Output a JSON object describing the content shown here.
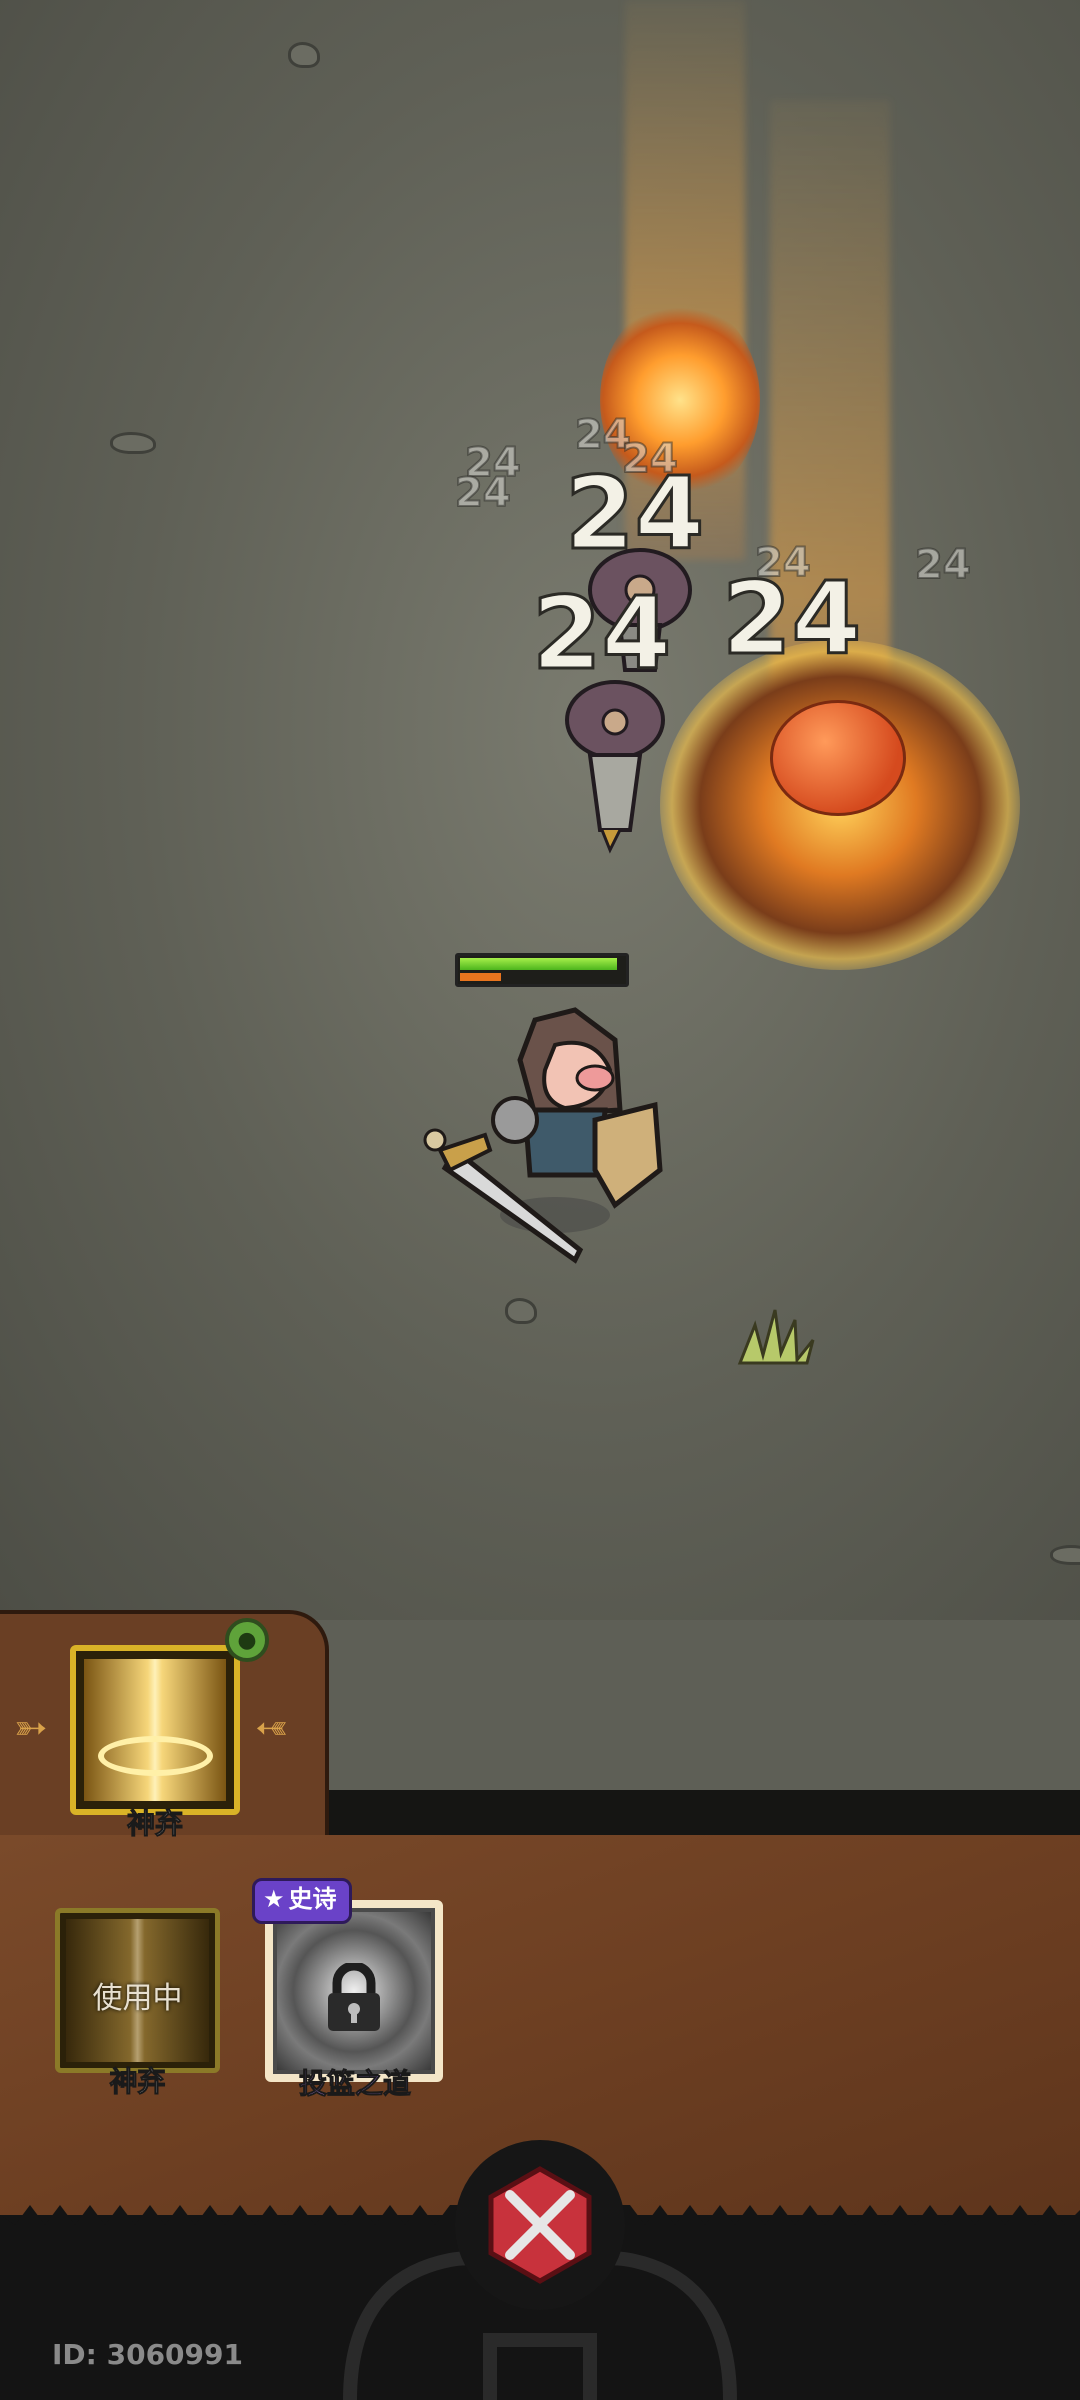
{
  "combat": {
    "damage_numbers_large": [
      "24",
      "24",
      "24"
    ],
    "damage_numbers_small": [
      "24",
      "24",
      "24",
      "24",
      "24",
      "24"
    ],
    "player_health_fraction": 0.97,
    "player_experience_fraction": 0.25
  },
  "equipped_skill": {
    "label": "神弃",
    "icon": "golden-light-pillar-icon",
    "badge_icon": "green-armor-badge-icon"
  },
  "skill_slots": [
    {
      "status": "使用中",
      "label": "神弃",
      "icon": "golden-light-pillar-icon"
    },
    {
      "rarity": "史诗",
      "label": "投篮之道",
      "icon": "locked-swirl-icon",
      "locked": true
    }
  ],
  "center_button": {
    "icon": "crossed-swords-close-icon"
  },
  "footer": {
    "id_text": "ID: 3060991"
  },
  "colors": {
    "accent_gold": "#d9b327",
    "epic_purple": "#6a42c8",
    "panel_brown": "#6d3f22"
  }
}
